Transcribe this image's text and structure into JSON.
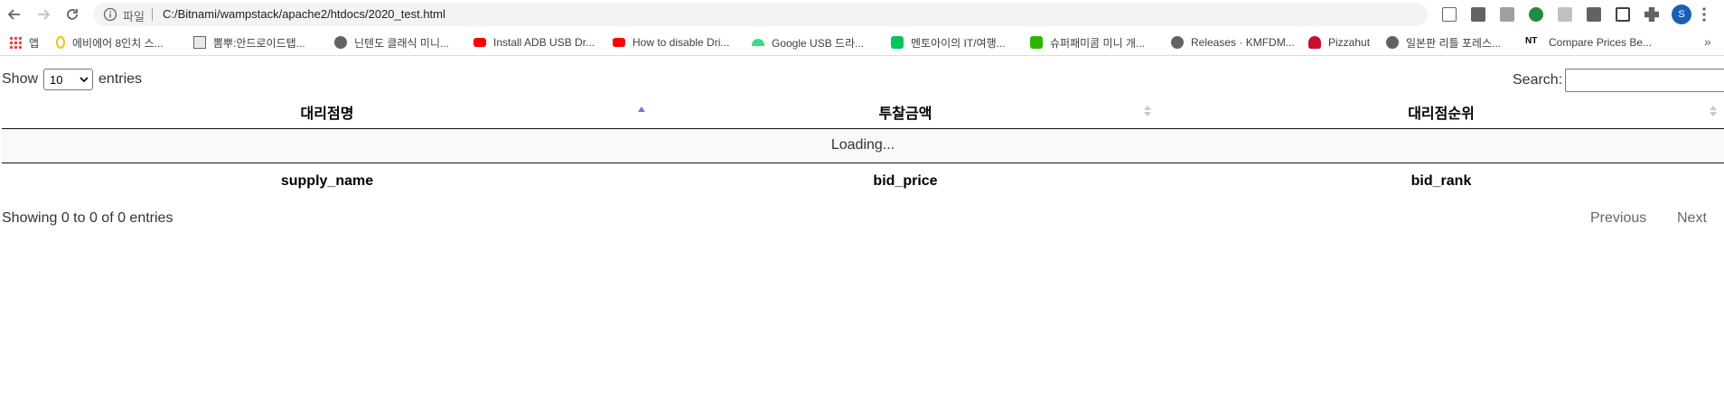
{
  "browser": {
    "omnibox_label": "파일",
    "url": "C:/Bitnami/wampstack/apache2/htdocs/2020_test.html",
    "profile_initial": "S"
  },
  "bookmarks": [
    {
      "label": "앱",
      "icon": "apps-grid-icon",
      "color": "#ea4335"
    },
    {
      "label": "에비에어 8인치 스...",
      "icon": "bookmark-icon",
      "color": "#f4c20d"
    },
    {
      "label": "뽐뿌:안드로이드탭...",
      "icon": "site-icon",
      "color": "#5f6368"
    },
    {
      "label": "닌텐도 클래식 미니...",
      "icon": "globe-icon",
      "color": "#5f6368"
    },
    {
      "label": "Install ADB USB Dr...",
      "icon": "youtube-icon",
      "color": "#ff0000"
    },
    {
      "label": "How to disable Dri...",
      "icon": "youtube-icon",
      "color": "#ff0000"
    },
    {
      "label": "Google USB 드라...",
      "icon": "android-icon",
      "color": "#3ddc84"
    },
    {
      "label": "멘토아이의 IT/여행...",
      "icon": "blog-icon",
      "color": "#03c75a"
    },
    {
      "label": "슈퍼패미콤 미니 개...",
      "icon": "chat-icon",
      "color": "#2db400"
    },
    {
      "label": "Releases · KMFDM...",
      "icon": "globe-icon",
      "color": "#5f6368"
    },
    {
      "label": "Pizzahut",
      "icon": "pizzahut-icon",
      "color": "#c8102e"
    },
    {
      "label": "일본판 리틀 포레스...",
      "icon": "globe-icon",
      "color": "#5f6368"
    },
    {
      "label": "Compare Prices Be...",
      "icon": "nt-icon",
      "color": "#000000"
    }
  ],
  "datatable": {
    "length_prefix": "Show",
    "length_value": "10",
    "length_suffix": "entries",
    "search_label": "Search:",
    "columns": [
      "대리점명",
      "투찰금액",
      "대리점순위"
    ],
    "loading_text": "Loading...",
    "footer_columns": [
      "supply_name",
      "bid_price",
      "bid_rank"
    ],
    "info": "Showing 0 to 0 of 0 entries",
    "previous_label": "Previous",
    "next_label": "Next"
  },
  "colors": {
    "sort_active": "#6b7ac9",
    "sort_inactive": "#c8c8c8"
  }
}
